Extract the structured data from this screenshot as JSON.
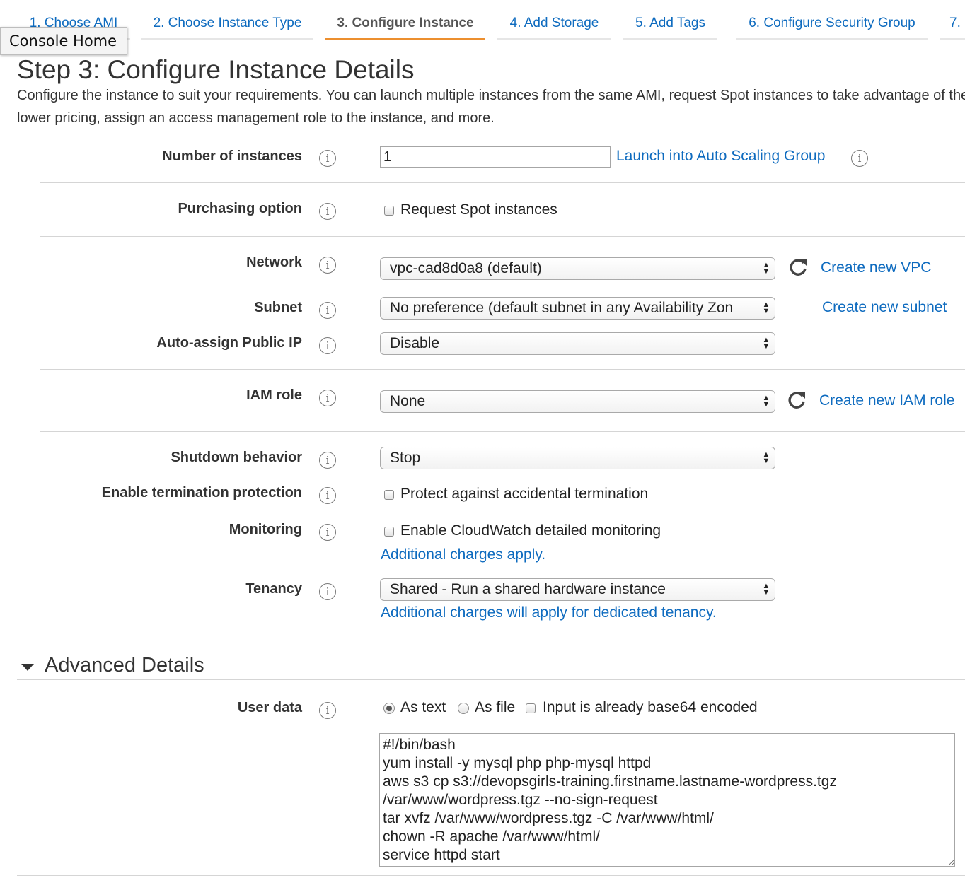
{
  "wizard_tabs": [
    {
      "label": "1. Choose AMI"
    },
    {
      "label": "2. Choose Instance Type"
    },
    {
      "label": "3. Configure Instance"
    },
    {
      "label": "4. Add Storage"
    },
    {
      "label": "5. Add Tags"
    },
    {
      "label": "6. Configure Security Group"
    },
    {
      "label": "7."
    }
  ],
  "active_tab": "3. Configure Instance",
  "tooltip": "Console Home",
  "header": {
    "title": "Step 3: Configure Instance Details",
    "description": "Configure the instance to suit your requirements. You can launch multiple instances from the same AMI, request Spot instances to take advantage of the lower pricing, assign an access management role to the instance, and more."
  },
  "form": {
    "number_of_instances": {
      "label": "Number of instances",
      "value": "1",
      "link": "Launch into Auto Scaling Group"
    },
    "purchasing_option": {
      "label": "Purchasing option",
      "checkbox_label": "Request Spot instances",
      "checked": false
    },
    "network": {
      "label": "Network",
      "value": "vpc-cad8d0a8 (default)",
      "link": "Create new VPC"
    },
    "subnet": {
      "label": "Subnet",
      "value": "No preference (default subnet in any Availability Zon",
      "link": "Create new subnet"
    },
    "auto_assign_ip": {
      "label": "Auto-assign Public IP",
      "value": "Disable"
    },
    "iam_role": {
      "label": "IAM role",
      "value": "None",
      "link": "Create new IAM role"
    },
    "shutdown_behavior": {
      "label": "Shutdown behavior",
      "value": "Stop"
    },
    "termination_protection": {
      "label": "Enable termination protection",
      "checkbox_label": "Protect against accidental termination",
      "checked": false
    },
    "monitoring": {
      "label": "Monitoring",
      "checkbox_label": "Enable CloudWatch detailed monitoring",
      "checked": false,
      "note": "Additional charges apply."
    },
    "tenancy": {
      "label": "Tenancy",
      "value": "Shared - Run a shared hardware instance",
      "note": "Additional charges will apply for dedicated tenancy."
    }
  },
  "advanced": {
    "title": "Advanced Details",
    "user_data": {
      "label": "User data",
      "options": [
        "As text",
        "As file"
      ],
      "selected": "As text",
      "base64_label": "Input is already base64 encoded",
      "base64_checked": false,
      "value": "#!/bin/bash\nyum install -y mysql php php-mysql httpd\naws s3 cp s3://devopsgirls-training.firstname.lastname-wordpress.tgz\n/var/www/wordpress.tgz --no-sign-request\ntar xvfz /var/www/wordpress.tgz -C /var/www/html/\nchown -R apache /var/www/html/\nservice httpd start"
    }
  },
  "icons": {
    "info": "info-icon",
    "refresh": "refresh-icon",
    "caret": "caret-down-icon",
    "select_arrows": "select-arrows-icon"
  },
  "colors": {
    "link": "#0e6bbf",
    "active_tab_underline": "#ec8f2f",
    "text": "#333333",
    "divider": "#d5d5d5"
  }
}
